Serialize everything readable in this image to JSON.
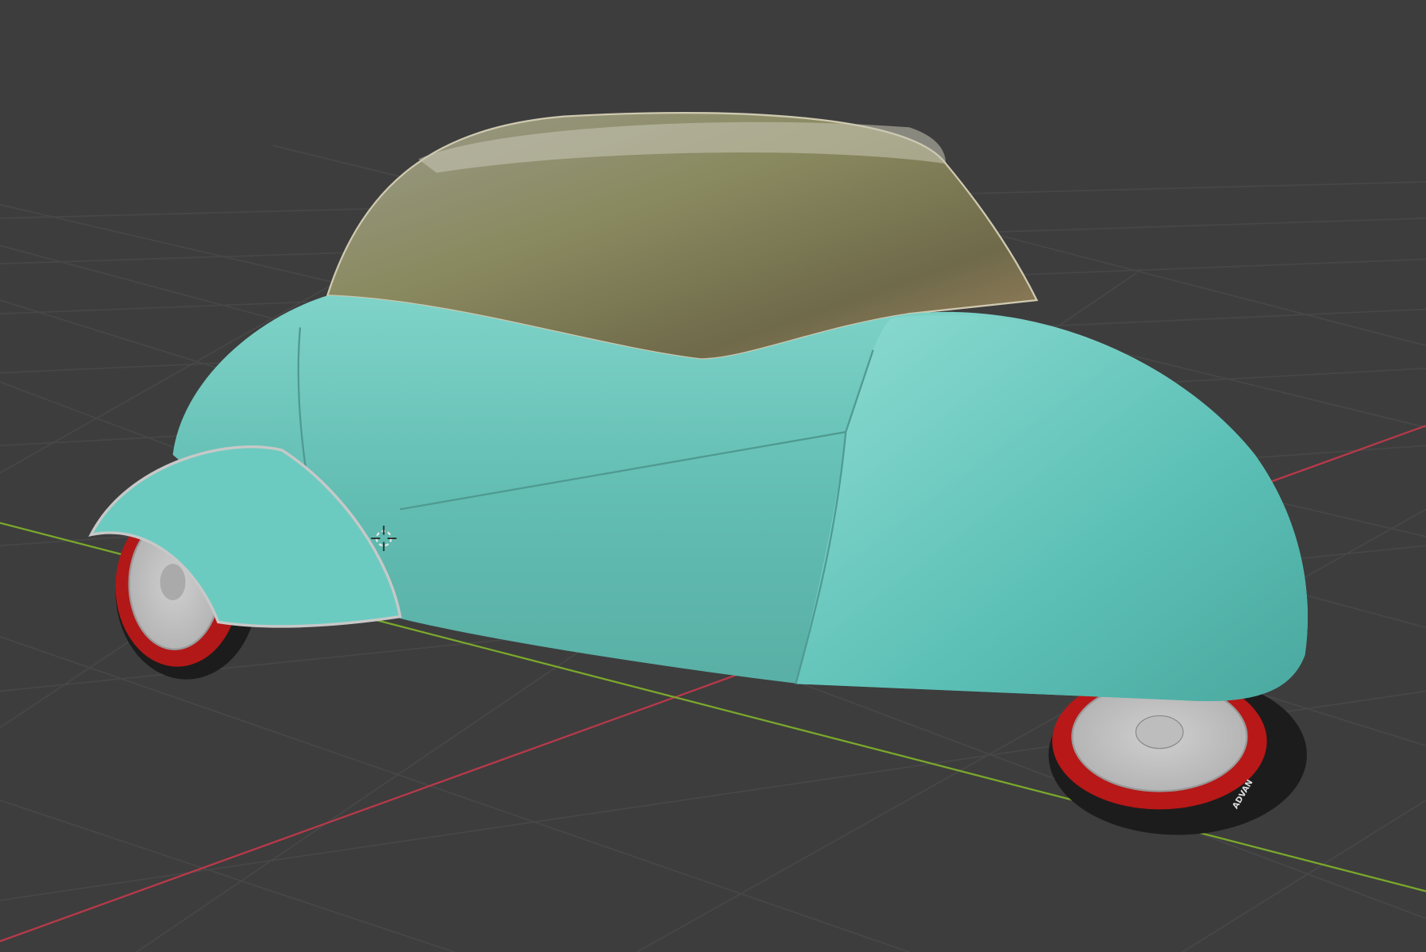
{
  "viewport": {
    "background": "#3d3d3d",
    "grid_color": "#4a4a4a",
    "x_axis_color": "#c0394a",
    "y_axis_color": "#7fb82c"
  },
  "car": {
    "body_color": "#62bdb2",
    "rim_color": "#c01818",
    "tire_brand": "ADVAN"
  }
}
